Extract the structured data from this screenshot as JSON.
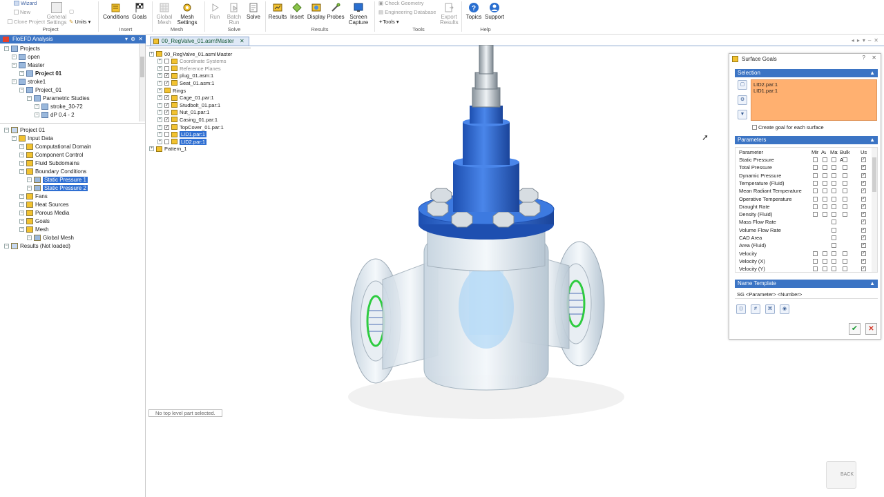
{
  "ribbon": {
    "wizard": "Wizard",
    "new": "New",
    "clone_project": "Clone Project",
    "general_settings": "General Settings",
    "units": "Units",
    "project_group": "Project",
    "conditions": "Conditions",
    "goals": "Goals",
    "insert_group": "Insert",
    "global_mesh": "Global Mesh",
    "mesh_settings": "Mesh Settings",
    "mesh_group": "Mesh",
    "run": "Run",
    "batch_run": "Batch Run",
    "solve_group": "Solve",
    "solve": "Solve",
    "results": "Results",
    "insert": "Insert",
    "display": "Display",
    "probes": "Probes",
    "screen_capture": "Screen Capture",
    "results_group": "Results",
    "check_geometry": "Check Geometry",
    "engineering_database": "Engineering Database",
    "tools": "Tools",
    "export_results": "Export Results",
    "tools_group": "Tools",
    "topics": "Topics",
    "support": "Support",
    "help_group": "Help"
  },
  "left_panel": {
    "title": "FloEFD Analysis",
    "projects_tree": [
      {
        "label": "Projects",
        "indent": 0
      },
      {
        "label": "open",
        "indent": 1
      },
      {
        "label": "Master",
        "indent": 1
      },
      {
        "label": "Project 01",
        "indent": 2,
        "bold": true
      },
      {
        "label": "stroke1",
        "indent": 1
      },
      {
        "label": "Project_01",
        "indent": 2
      },
      {
        "label": "Parametric Studies",
        "indent": 3
      },
      {
        "label": "stroke_30-72",
        "indent": 4
      },
      {
        "label": "dP 0.4 - 2",
        "indent": 4
      }
    ],
    "analysis_tree": [
      {
        "label": "Project 01",
        "indent": 0
      },
      {
        "label": "Input Data",
        "indent": 1
      },
      {
        "label": "Computational Domain",
        "indent": 2
      },
      {
        "label": "Component Control",
        "indent": 2
      },
      {
        "label": "Fluid Subdomains",
        "indent": 2
      },
      {
        "label": "Boundary Conditions",
        "indent": 2
      },
      {
        "label": "Static Pressure 1",
        "indent": 3,
        "selected": true
      },
      {
        "label": "Static Pressure 2",
        "indent": 3,
        "selected": true
      },
      {
        "label": "Fans",
        "indent": 2
      },
      {
        "label": "Heat Sources",
        "indent": 2
      },
      {
        "label": "Porous Media",
        "indent": 2
      },
      {
        "label": "Goals",
        "indent": 2
      },
      {
        "label": "Mesh",
        "indent": 2
      },
      {
        "label": "Global Mesh",
        "indent": 3
      },
      {
        "label": "Results (Not loaded)",
        "indent": 0
      }
    ]
  },
  "document": {
    "tab_title": "00_RegValve_01.asm!Master",
    "assembly_tree": [
      {
        "label": "00_RegValve_01.asm!Master",
        "indent": 0,
        "check": "none"
      },
      {
        "label": "Coordinate Systems",
        "indent": 1,
        "check": "empty",
        "faded": true
      },
      {
        "label": "Reference Planes",
        "indent": 1,
        "check": "empty",
        "faded": true
      },
      {
        "label": "plug_01.asm:1",
        "indent": 1,
        "check": "checked"
      },
      {
        "label": "Seat_01.asm:1",
        "indent": 1,
        "check": "checked"
      },
      {
        "label": "Rings",
        "indent": 1,
        "check": "none"
      },
      {
        "label": "Cage_01.par:1",
        "indent": 1,
        "check": "checked"
      },
      {
        "label": "Studbolt_01.par:1",
        "indent": 1,
        "check": "checked"
      },
      {
        "label": "Nut_01.par:1",
        "indent": 1,
        "check": "checked"
      },
      {
        "label": "Casing_01.par:1",
        "indent": 1,
        "check": "checked"
      },
      {
        "label": "TopCover_01.par:1",
        "indent": 1,
        "check": "checked"
      },
      {
        "label": "LID1.par:1",
        "indent": 1,
        "check": "empty",
        "selected": true
      },
      {
        "label": "LID2.par:1",
        "indent": 1,
        "check": "empty",
        "selected": true
      },
      {
        "label": "Pattern_1",
        "indent": 0,
        "check": "none"
      }
    ],
    "status_text": "No top level part selected.",
    "view_cube_label": "BACK"
  },
  "dialog": {
    "title": "Surface Goals",
    "selection_header": "Selection",
    "selected_faces": [
      "LID2.par:1",
      "LID1.par:1"
    ],
    "create_goal_label": "Create goal for each surface",
    "parameters_header": "Parameters",
    "columns": [
      "Parameter",
      "Mir",
      "Av",
      "Max",
      "Bulk Av",
      "Use"
    ],
    "rows": [
      {
        "name": "Static Pressure",
        "cbs": 4,
        "use": true
      },
      {
        "name": "Total Pressure",
        "cbs": 4,
        "use": true
      },
      {
        "name": "Dynamic Pressure",
        "cbs": 4,
        "use": true
      },
      {
        "name": "Temperature (Fluid)",
        "cbs": 4,
        "use": true
      },
      {
        "name": "Mean Radiant Temperature",
        "cbs": 4,
        "use": true
      },
      {
        "name": "Operative Temperature",
        "cbs": 4,
        "use": true
      },
      {
        "name": "Draught Rate",
        "cbs": 4,
        "use": true
      },
      {
        "name": "Density (Fluid)",
        "cbs": 4,
        "use": true
      },
      {
        "name": "Mass Flow Rate",
        "cbs": 1,
        "use": true
      },
      {
        "name": "Volume Flow Rate",
        "cbs": 1,
        "use": true
      },
      {
        "name": "CAD Area",
        "cbs": 1,
        "use": true
      },
      {
        "name": "Area (Fluid)",
        "cbs": 1,
        "use": true
      },
      {
        "name": "Velocity",
        "cbs": 4,
        "use": true
      },
      {
        "name": "Velocity (X)",
        "cbs": 4,
        "use": true
      },
      {
        "name": "Velocity (Y)",
        "cbs": 4,
        "use": true
      }
    ],
    "name_template_header": "Name Template",
    "name_template_value": "SG <Parameter> <Number>"
  },
  "colors": {
    "accent": "#3b74c4",
    "selection": "#2f6fd2",
    "selection_list": "#ffb070",
    "valve_blue": "#2f6fd6",
    "ok_green": "#1e9a36",
    "cancel_red": "#d43a2b"
  }
}
